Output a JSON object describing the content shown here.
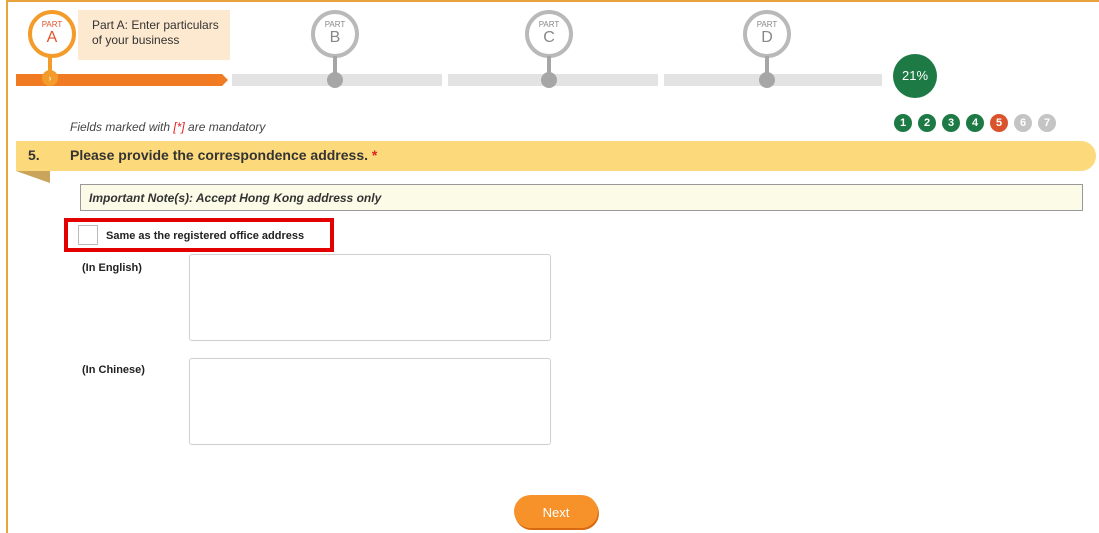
{
  "progress": {
    "parts": [
      {
        "small": "PART",
        "letter": "A"
      },
      {
        "small": "PART",
        "letter": "B"
      },
      {
        "small": "PART",
        "letter": "C"
      },
      {
        "small": "PART",
        "letter": "D"
      }
    ],
    "active_part_tip": "Part A: Enter particulars of your business",
    "percent_text": "21%",
    "arrow_glyph": "›"
  },
  "steps": [
    "1",
    "2",
    "3",
    "4",
    "5",
    "6",
    "7"
  ],
  "form": {
    "mandatory_prefix": "Fields marked with ",
    "mandatory_marker": "[*]",
    "mandatory_suffix": " are mandatory",
    "question_number": "5.",
    "question_text": "Please provide the correspondence address.",
    "required_star": "*",
    "note": "Important Note(s): Accept Hong Kong address only",
    "same_as_label": "Same as the registered office address",
    "english_label": "(In English)",
    "chinese_label": "(In Chinese)",
    "english_value": "",
    "chinese_value": ""
  },
  "actions": {
    "next_label": "Next"
  },
  "colors": {
    "accent": "#f7922a",
    "done": "#1d7a45",
    "current": "#d9532c",
    "highlight": "#e30000",
    "band": "#fcd97b"
  }
}
